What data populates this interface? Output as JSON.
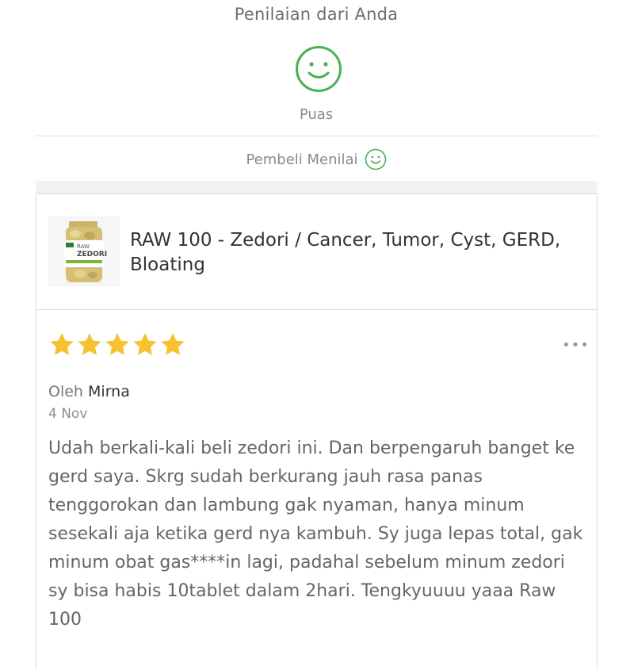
{
  "rating_section": {
    "title": "Penilaian dari Anda",
    "smiley_icon": "smile-face-icon",
    "rating_label": "Puas",
    "buyer_label": "Pembeli Menilai",
    "accent_color": "#4caf50"
  },
  "product": {
    "image_icon": "product-bottle-image",
    "name": "RAW 100 - Zedori / Cancer, Tumor, Cyst, GERD, Bloating"
  },
  "review": {
    "stars": 5,
    "star_color": "#f7c230",
    "more_label": "•••",
    "by_prefix": "Oleh",
    "author": "Mirna",
    "date": "4 Nov",
    "text": "Udah berkali-kali beli zedori ini. Dan berpengaruh banget ke gerd saya. Skrg sudah berkurang jauh rasa panas tenggorokan dan lambung gak nyaman, hanya minum sesekali aja ketika gerd nya kambuh. Sy juga lepas total, gak minum obat gas****in lagi, padahal sebelum minum zedori sy bisa habis 10tablet dalam 2hari. Tengkyuuuu yaaa Raw 100"
  }
}
